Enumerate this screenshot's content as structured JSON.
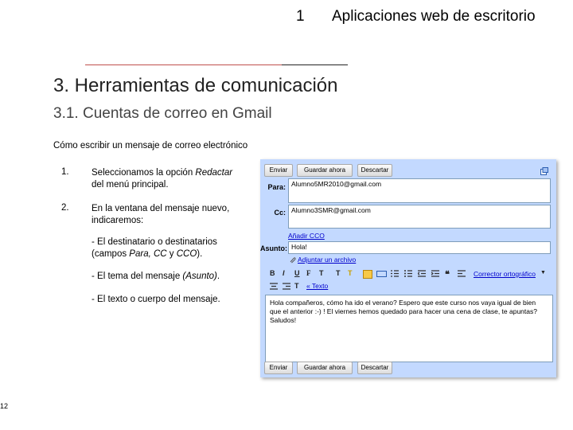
{
  "header": {
    "number": "1",
    "title": "Aplicaciones web de escritorio"
  },
  "heading": "3. Herramientas de comunicación",
  "subheading": "3.1. Cuentas de correo en Gmail",
  "intro": "Cómo escribir un mensaje de correo electrónico",
  "steps": [
    {
      "num": "1.",
      "text_pre": "Seleccionamos la opción ",
      "text_em": "Redactar",
      "text_post": " del menú principal."
    },
    {
      "num": "2.",
      "text": "En la ventana del mensaje nuevo, indicaremos:"
    }
  ],
  "bullets": {
    "b1_pre": "- El destinatario o destinatarios (campos ",
    "b1_em1": "Para, CC",
    "b1_mid": " y ",
    "b1_em2": "CCO",
    "b1_post": ").",
    "b2_pre": "- El tema del mensaje ",
    "b2_em": "(Asunto)",
    "b2_post": ".",
    "b3": "- El texto o cuerpo del mensaje."
  },
  "page_number": "12",
  "gmail": {
    "send": "Enviar",
    "save_now": "Guardar ahora",
    "discard": "Descartar",
    "to_label": "Para:",
    "to_value": "Alumno5MR2010@gmail.com",
    "cc_label": "Cc:",
    "cc_value": "Alumno3SMR@gmail.com",
    "add_bcc": "Añadir CCO",
    "subject_label": "Asunto:",
    "subject_value": "Hola!",
    "attach": "Adjuntar un archivo",
    "spell": "Corrector ortográfico",
    "plain_text": "« Texto",
    "body": "Hola compañeros, cómo ha ido el verano? Espero que este curso nos vaya igual de bien que el anterior :-) ! El viernes hemos quedado para hacer una cena de clase, te apuntas? Saludos!"
  }
}
